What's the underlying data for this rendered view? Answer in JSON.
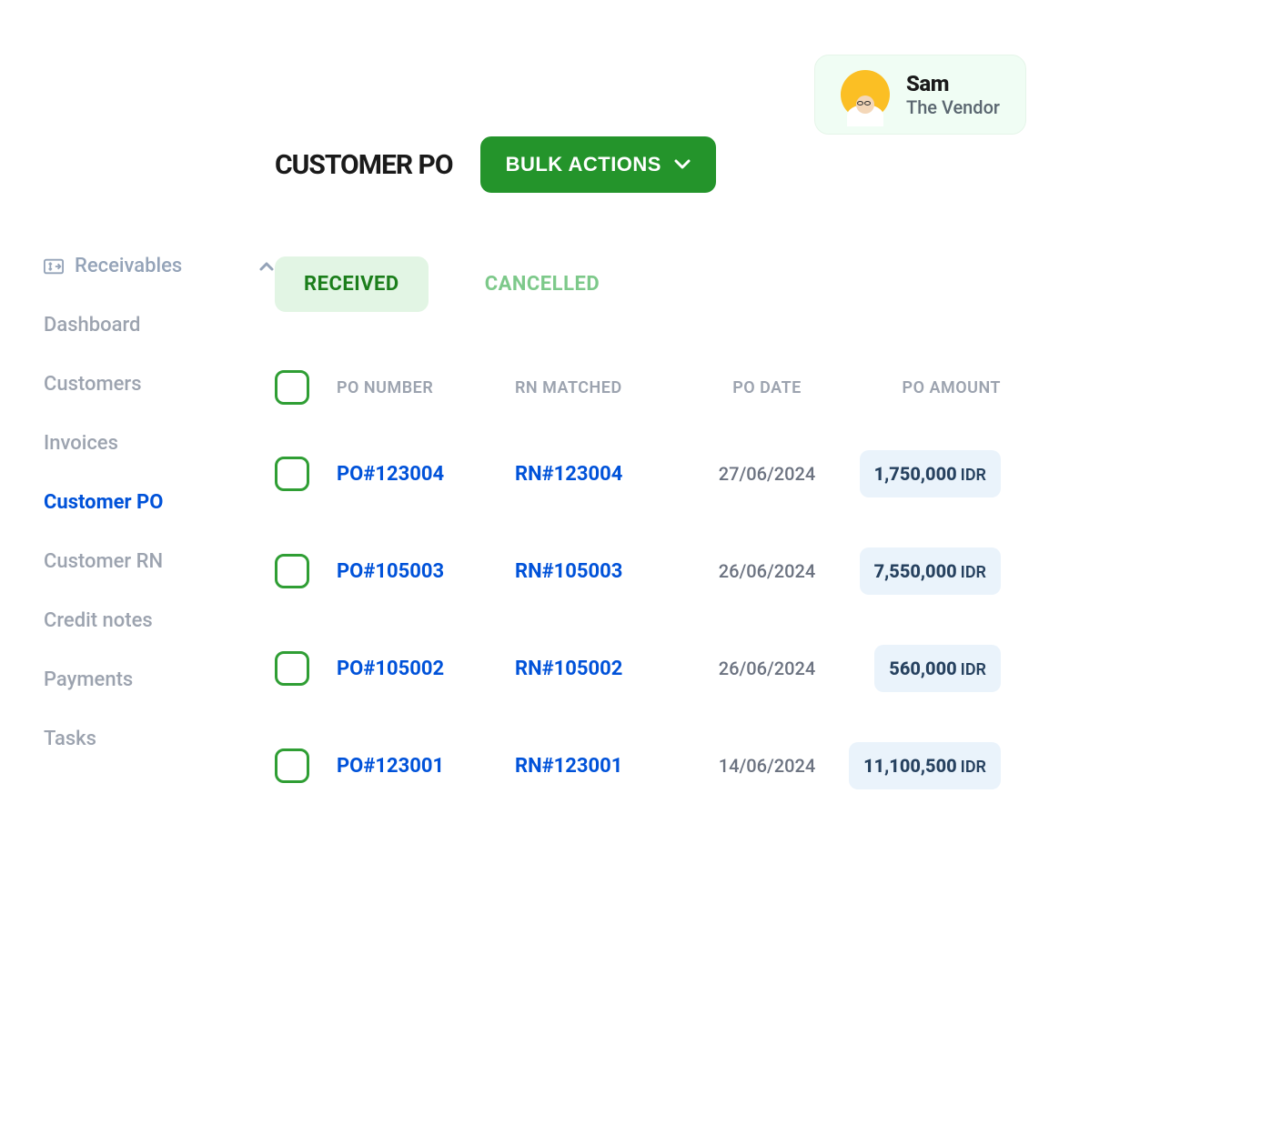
{
  "user": {
    "name": "Sam",
    "role": "The Vendor"
  },
  "sidebar": {
    "header_label": "Receivables",
    "items": [
      {
        "label": "Dashboard",
        "active": false
      },
      {
        "label": "Customers",
        "active": false
      },
      {
        "label": "Invoices",
        "active": false
      },
      {
        "label": "Customer PO",
        "active": true
      },
      {
        "label": "Customer RN",
        "active": false
      },
      {
        "label": "Credit notes",
        "active": false
      },
      {
        "label": "Payments",
        "active": false
      },
      {
        "label": "Tasks",
        "active": false
      }
    ]
  },
  "page": {
    "title": "CUSTOMER PO",
    "bulk_actions_label": "BULK ACTIONS"
  },
  "tabs": [
    {
      "label": "RECEIVED",
      "active": true
    },
    {
      "label": "CANCELLED",
      "active": false
    }
  ],
  "table": {
    "headers": {
      "po_number": "PO NUMBER",
      "rn_matched": "RN MATCHED",
      "po_date": "PO DATE",
      "po_amount": "PO AMOUNT"
    },
    "rows": [
      {
        "po_number": "PO#123004",
        "rn_matched": "RN#123004",
        "po_date": "27/06/2024",
        "amount": "1,750,000",
        "currency": "IDR"
      },
      {
        "po_number": "PO#105003",
        "rn_matched": "RN#105003",
        "po_date": "26/06/2024",
        "amount": "7,550,000",
        "currency": "IDR"
      },
      {
        "po_number": "PO#105002",
        "rn_matched": "RN#105002",
        "po_date": "26/06/2024",
        "amount": "560,000",
        "currency": "IDR"
      },
      {
        "po_number": "PO#123001",
        "rn_matched": "RN#123001",
        "po_date": "14/06/2024",
        "amount": "11,100,500",
        "currency": "IDR"
      }
    ]
  }
}
